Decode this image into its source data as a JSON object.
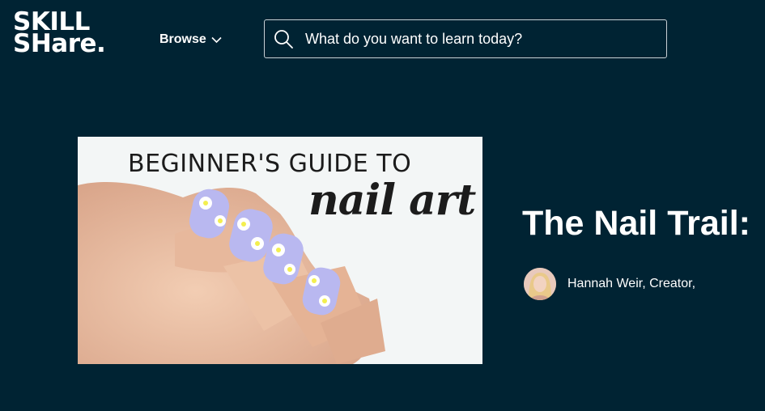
{
  "header": {
    "logo_line1": "SKILL",
    "logo_line2": "SHare.",
    "browse_label": "Browse",
    "search_placeholder": "What do you want to learn today?"
  },
  "course": {
    "thumbnail": {
      "title_line": "BEGINNER'S GUIDE TO",
      "script_text": "nail art"
    },
    "title": "The Nail Trail:",
    "creator": "Hannah Weir, Creator,"
  },
  "colors": {
    "background": "#002333",
    "text": "#ffffff",
    "nail_polish": "#b8b8f0",
    "flower_center": "#f3ef4f"
  }
}
